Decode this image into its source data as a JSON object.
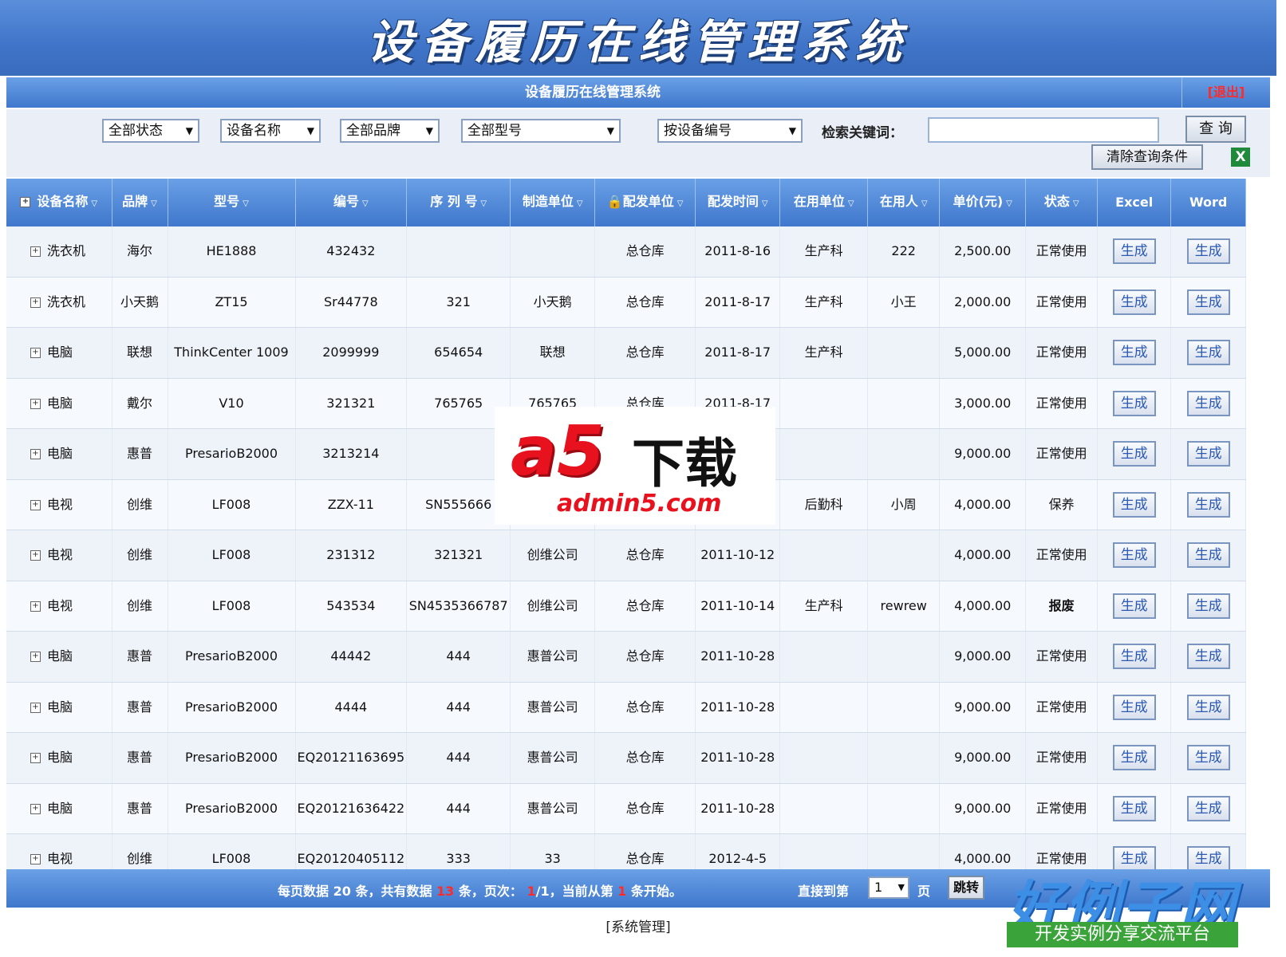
{
  "banner": {
    "title": "设备履历在线管理系统"
  },
  "subbar": {
    "title": "设备履历在线管理系统",
    "logout": "[退出]"
  },
  "filters": {
    "status": "全部状态",
    "device_name": "设备名称",
    "brand": "全部品牌",
    "model": "全部型号",
    "by_number": "按设备编号",
    "keyword_label": "检索关键词：",
    "keyword_value": "",
    "query_button": "查 询",
    "clear_button": "清除查询条件"
  },
  "columns": [
    "设备名称",
    "品牌",
    "型号",
    "编号",
    "序 列 号",
    "制造单位",
    "配发单位",
    "配发时间",
    "在用单位",
    "在用人",
    "单价(元)",
    "状态",
    "Excel",
    "Word"
  ],
  "rows": [
    {
      "name": "洗衣机",
      "brand": "海尔",
      "model": "HE1888",
      "number": "432432",
      "serial": "",
      "maker": "",
      "issuer": "总仓库",
      "date": "2011-8-16",
      "dept": "生产科",
      "user": "222",
      "price": "2,500.00",
      "status": "正常使用"
    },
    {
      "name": "洗衣机",
      "brand": "小天鹅",
      "model": "ZT15",
      "number": "Sr44778",
      "serial": "321",
      "maker": "小天鹅",
      "issuer": "总仓库",
      "date": "2011-8-17",
      "dept": "生产科",
      "user": "小王",
      "price": "2,000.00",
      "status": "正常使用"
    },
    {
      "name": "电脑",
      "brand": "联想",
      "model": "ThinkCenter 1009",
      "number": "2099999",
      "serial": "654654",
      "maker": "联想",
      "issuer": "总仓库",
      "date": "2011-8-17",
      "dept": "生产科",
      "user": "",
      "price": "5,000.00",
      "status": "正常使用"
    },
    {
      "name": "电脑",
      "brand": "戴尔",
      "model": "V10",
      "number": "321321",
      "serial": "765765",
      "maker": "765765",
      "issuer": "总仓库",
      "date": "2011-8-17",
      "dept": "",
      "user": "",
      "price": "3,000.00",
      "status": "正常使用"
    },
    {
      "name": "电脑",
      "brand": "惠普",
      "model": "PresarioB2000",
      "number": "3213214",
      "serial": "",
      "maker": "",
      "issuer": "",
      "date": "",
      "dept": "",
      "user": "",
      "price": "9,000.00",
      "status": "正常使用"
    },
    {
      "name": "电视",
      "brand": "创维",
      "model": "LF008",
      "number": "ZZX-11",
      "serial": "SN555666",
      "maker": "",
      "issuer": "",
      "date": "",
      "dept": "后勤科",
      "user": "小周",
      "price": "4,000.00",
      "status": "保养"
    },
    {
      "name": "电视",
      "brand": "创维",
      "model": "LF008",
      "number": "231312",
      "serial": "321321",
      "maker": "创维公司",
      "issuer": "总仓库",
      "date": "2011-10-12",
      "dept": "",
      "user": "",
      "price": "4,000.00",
      "status": "正常使用"
    },
    {
      "name": "电视",
      "brand": "创维",
      "model": "LF008",
      "number": "543534",
      "serial": "SN4535366787",
      "maker": "创维公司",
      "issuer": "总仓库",
      "date": "2011-10-14",
      "dept": "生产科",
      "user": "rewrew",
      "price": "4,000.00",
      "status": "报废"
    },
    {
      "name": "电脑",
      "brand": "惠普",
      "model": "PresarioB2000",
      "number": "44442",
      "serial": "444",
      "maker": "惠普公司",
      "issuer": "总仓库",
      "date": "2011-10-28",
      "dept": "",
      "user": "",
      "price": "9,000.00",
      "status": "正常使用"
    },
    {
      "name": "电脑",
      "brand": "惠普",
      "model": "PresarioB2000",
      "number": "4444",
      "serial": "444",
      "maker": "惠普公司",
      "issuer": "总仓库",
      "date": "2011-10-28",
      "dept": "",
      "user": "",
      "price": "9,000.00",
      "status": "正常使用"
    },
    {
      "name": "电脑",
      "brand": "惠普",
      "model": "PresarioB2000",
      "number": "EQ20121163695",
      "serial": "444",
      "maker": "惠普公司",
      "issuer": "总仓库",
      "date": "2011-10-28",
      "dept": "",
      "user": "",
      "price": "9,000.00",
      "status": "正常使用"
    },
    {
      "name": "电脑",
      "brand": "惠普",
      "model": "PresarioB2000",
      "number": "EQ20121636422",
      "serial": "444",
      "maker": "惠普公司",
      "issuer": "总仓库",
      "date": "2011-10-28",
      "dept": "",
      "user": "",
      "price": "9,000.00",
      "status": "正常使用"
    },
    {
      "name": "电视",
      "brand": "创维",
      "model": "LF008",
      "number": "EQ20120405112",
      "serial": "333",
      "maker": "33",
      "issuer": "总仓库",
      "date": "2012-4-5",
      "dept": "",
      "user": "",
      "price": "4,000.00",
      "status": "正常使用"
    }
  ],
  "generate_label": "生成",
  "pager": {
    "t1": "每页数据",
    "per_page": "20",
    "t2": "条，共有数据",
    "total": "13",
    "t3": "条，页次：",
    "page": "1",
    "t4": "/1，当前从第",
    "start": "1",
    "t5": "条开始。",
    "jump_label": "直接到第",
    "page_select": "1",
    "page_unit": "页",
    "jump_button": "跳转"
  },
  "footer": {
    "link": "[系统管理]"
  },
  "watermarks": {
    "a5_logo": "a5",
    "a5_text": "下载",
    "a5_domain": "admin5.com",
    "site_big": "好例子网",
    "site_small": "开发实例分享交流平台"
  },
  "colors": {
    "header_blue": "#3f77cc",
    "scrap_red": "#e8121e",
    "logout_red": "#ff2a2a"
  }
}
